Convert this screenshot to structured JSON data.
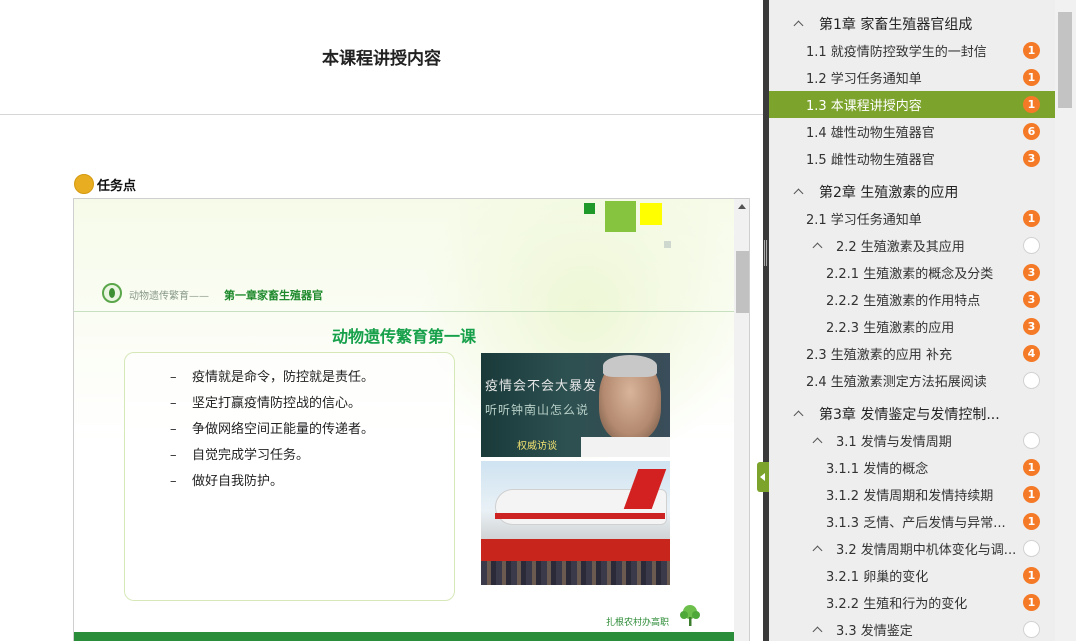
{
  "main": {
    "title": "本课程讲授内容",
    "task_label": "任务点"
  },
  "slide": {
    "course_name": "动物遗传繁育——",
    "chapter_name": "第一章家畜生殖器官",
    "heading": "动物遗传繁育第一课",
    "bullets": [
      "疫情就是命令，防控就是责任。",
      "坚定打赢疫情防控战的信心。",
      "争做网络空间正能量的传递者。",
      "自觉完成学习任务。",
      "做好自我防护。"
    ],
    "bullet_marker": "–",
    "photo1_caption_1": "疫情会不会大暴发",
    "photo1_caption_2": "听听钟南山怎么说",
    "photo1_badge": "权威访谈",
    "footer": "扎根农村办高职",
    "colors": {
      "accent_green": "#16a04a",
      "square_green": "#86c440",
      "square_yellow": "#ffff00",
      "bottom_bar": "#2a8d3a"
    }
  },
  "sidebar": {
    "active_color": "#7ca32c",
    "badge_color": "#f57a27",
    "items": [
      {
        "label": "第1章 家畜生殖器官组成",
        "type": "chapter",
        "level": 0,
        "chevron": true
      },
      {
        "label": "1.1 就疫情防控致学生的一封信",
        "type": "section",
        "level": 1,
        "badge": "1"
      },
      {
        "label": "1.2 学习任务通知单",
        "type": "section",
        "level": 1,
        "badge": "1"
      },
      {
        "label": "1.3 本课程讲授内容",
        "type": "section",
        "level": 1,
        "badge": "1",
        "active": true
      },
      {
        "label": "1.4 雄性动物生殖器官",
        "type": "section",
        "level": 1,
        "badge": "6"
      },
      {
        "label": "1.5 雌性动物生殖器官",
        "type": "section",
        "level": 1,
        "badge": "3"
      },
      {
        "label": "第2章 生殖激素的应用",
        "type": "chapter",
        "level": 0,
        "chevron": true
      },
      {
        "label": "2.1 学习任务通知单",
        "type": "section",
        "level": 1,
        "badge": "1"
      },
      {
        "label": "2.2 生殖激素及其应用",
        "type": "section",
        "level": 2,
        "chevron": true,
        "badge": ""
      },
      {
        "label": "2.2.1 生殖激素的概念及分类",
        "type": "section",
        "level": 3,
        "badge": "3"
      },
      {
        "label": "2.2.2 生殖激素的作用特点",
        "type": "section",
        "level": 3,
        "badge": "3"
      },
      {
        "label": "2.2.3 生殖激素的应用",
        "type": "section",
        "level": 3,
        "badge": "3"
      },
      {
        "label": "2.3 生殖激素的应用 补充",
        "type": "section",
        "level": 1,
        "badge": "4"
      },
      {
        "label": "2.4 生殖激素测定方法拓展阅读",
        "type": "section",
        "level": 1,
        "badge": ""
      },
      {
        "label": "第3章 发情鉴定与发情控制...",
        "type": "chapter",
        "level": 0,
        "chevron": true
      },
      {
        "label": "3.1 发情与发情周期",
        "type": "section",
        "level": 2,
        "chevron": true,
        "badge": ""
      },
      {
        "label": "3.1.1 发情的概念",
        "type": "section",
        "level": 3,
        "badge": "1"
      },
      {
        "label": "3.1.2 发情周期和发情持续期",
        "type": "section",
        "level": 3,
        "badge": "1"
      },
      {
        "label": "3.1.3 乏情、产后发情与异常...",
        "type": "section",
        "level": 3,
        "badge": "1"
      },
      {
        "label": "3.2 发情周期中机体变化与调...",
        "type": "section",
        "level": 2,
        "chevron": true,
        "badge": ""
      },
      {
        "label": "3.2.1 卵巢的变化",
        "type": "section",
        "level": 3,
        "badge": "1"
      },
      {
        "label": "3.2.2 生殖和行为的变化",
        "type": "section",
        "level": 3,
        "badge": "1"
      },
      {
        "label": "3.3 发情鉴定",
        "type": "section",
        "level": 2,
        "chevron": true,
        "badge": ""
      }
    ]
  }
}
